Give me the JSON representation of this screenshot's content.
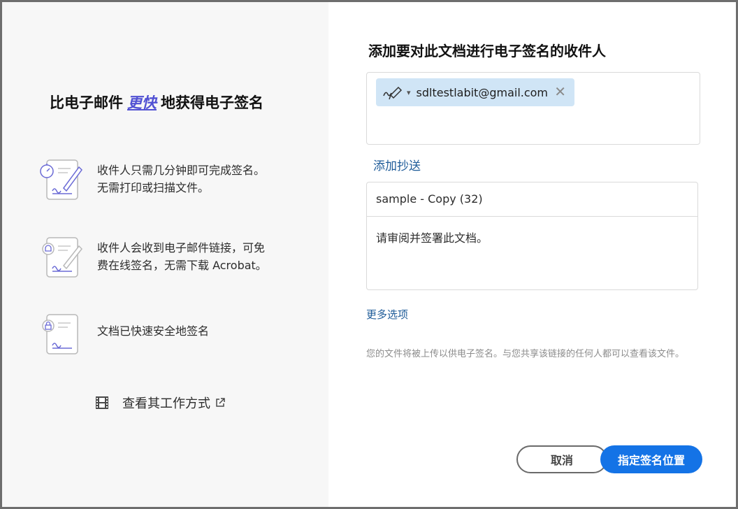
{
  "left_panel": {
    "headline_prefix": "比电子邮件",
    "headline_emphasis": "更快",
    "headline_suffix": "地获得电子签名",
    "features": [
      {
        "icon": "timer-signature-doc-icon",
        "line1": "收件人只需几分钟即可完成签名。",
        "line2": "无需打印或扫描文件。"
      },
      {
        "icon": "email-link-signature-doc-icon",
        "line1": "收件人会收到电子邮件链接，可免",
        "line2": "费在线签名，无需下载 Acrobat。"
      },
      {
        "icon": "lock-signature-doc-icon",
        "line1": "文档已快速安全地签名",
        "line2": ""
      }
    ],
    "how_it_works": "查看其工作方式"
  },
  "right_panel": {
    "title": "添加要对此文档进行电子签名的收件人",
    "recipient_email": "sdltestlabit@gmail.com",
    "add_cc": "添加抄送",
    "message_title": "sample - Copy (32)",
    "message_body": "请审阅并签署此文档。",
    "more_options": "更多选项",
    "note": "您的文件将被上传以供电子签名。与您共享该链接的任何人都可以查看该文件。",
    "cancel_label": "取消",
    "primary_label": "指定签名位置"
  },
  "colors": {
    "accent": "#1473e6",
    "link": "#1f5c99",
    "emphasis": "#5151d3",
    "chip_bg": "#d0e5f6",
    "left_bg": "#f7f7f7"
  }
}
